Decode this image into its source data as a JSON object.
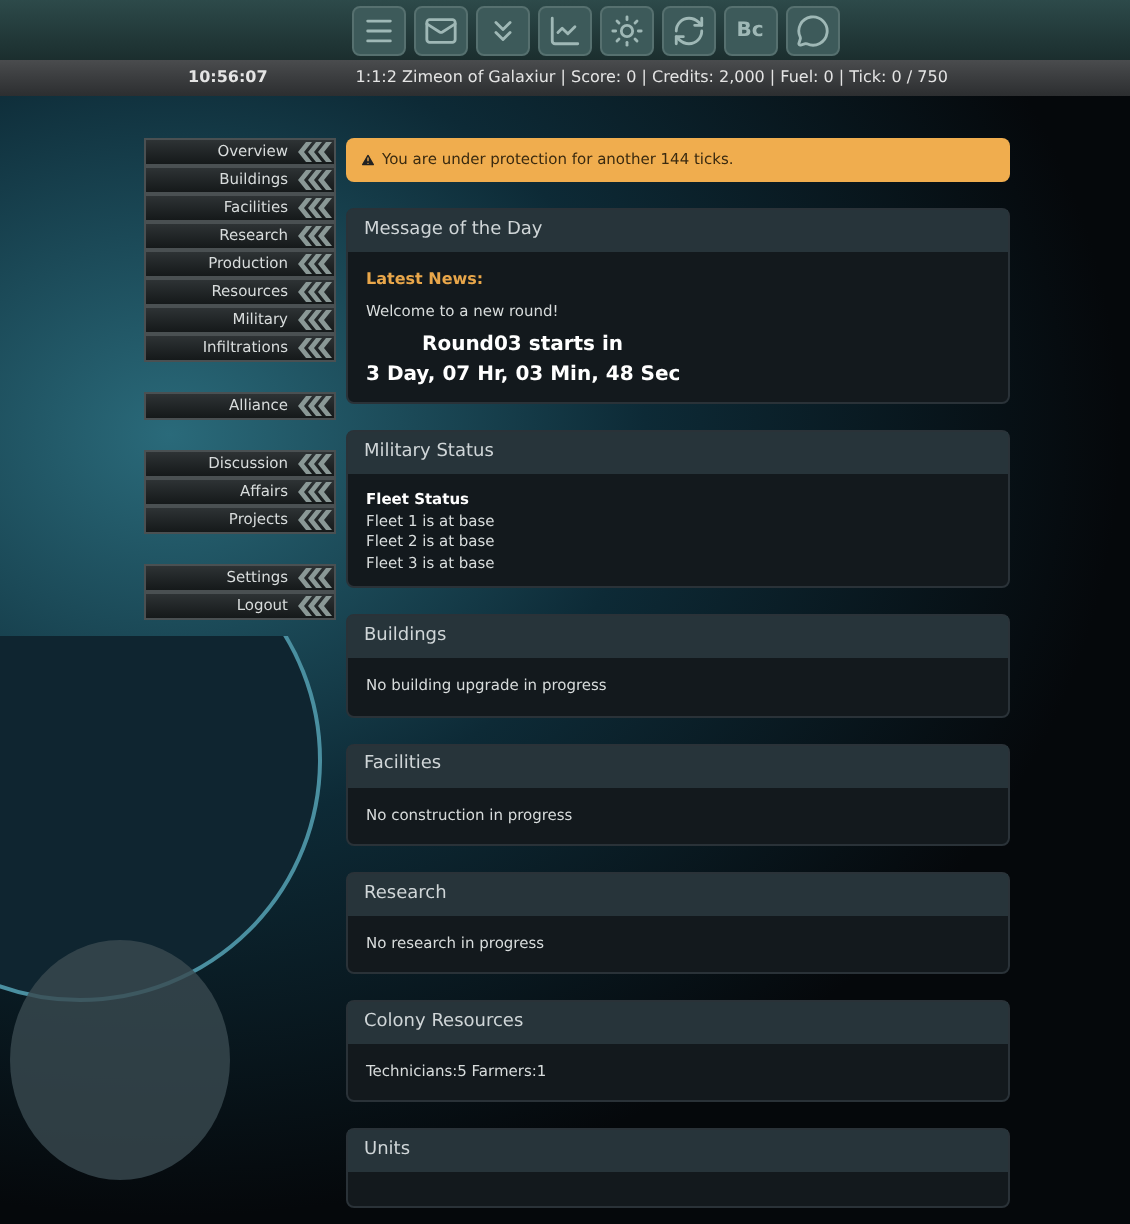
{
  "toolbar": [
    {
      "kind": "menu"
    },
    {
      "kind": "mail"
    },
    {
      "kind": "chevrons"
    },
    {
      "kind": "chart"
    },
    {
      "kind": "sun"
    },
    {
      "kind": "cycle"
    },
    {
      "kind": "label",
      "text": "Bc"
    },
    {
      "kind": "chat"
    }
  ],
  "status_bar": {
    "time": "10:56:07",
    "info": "1:1:2 Zimeon of Galaxiur | Score: 0 | Credits: 2,000 | Fuel: 0 | Tick: 0 / 750"
  },
  "nav_groups": [
    [
      "Overview",
      "Buildings",
      "Facilities",
      "Research",
      "Production",
      "Resources",
      "Military",
      "Infiltrations"
    ],
    [
      "Alliance"
    ],
    [
      "Discussion",
      "Affairs",
      "Projects"
    ],
    [
      "Settings",
      "Logout"
    ]
  ],
  "alert": "You are under protection for another 144 ticks.",
  "panels": [
    {
      "title": "Message of the Day",
      "content": [
        {
          "kind": "news_heading",
          "text": "Latest News:"
        },
        {
          "kind": "text",
          "text": "Welcome to a new round!"
        },
        {
          "kind": "big_indented",
          "text": "Round03 starts in"
        },
        {
          "kind": "big",
          "text": "3 Day, 07 Hr, 03 Min, 48 Sec"
        }
      ]
    },
    {
      "title": "Military Status",
      "content": [
        {
          "kind": "bold",
          "text": "Fleet Status"
        },
        {
          "kind": "line",
          "text": "Fleet 1 is at base"
        },
        {
          "kind": "line",
          "text": "Fleet 2 is at base"
        },
        {
          "kind": "line",
          "text": "Fleet 3 is at base"
        }
      ]
    },
    {
      "title": "Buildings",
      "content": [
        {
          "kind": "text",
          "text": "No building upgrade in progress"
        }
      ]
    },
    {
      "title": "Facilities",
      "content": [
        {
          "kind": "text",
          "text": "No construction in progress"
        }
      ]
    },
    {
      "title": "Research",
      "content": [
        {
          "kind": "text",
          "text": "No research in progress"
        }
      ]
    },
    {
      "title": "Colony Resources",
      "content": [
        {
          "kind": "text",
          "text": "Technicians:5 Farmers:1"
        }
      ]
    },
    {
      "title": "Units"
    }
  ]
}
